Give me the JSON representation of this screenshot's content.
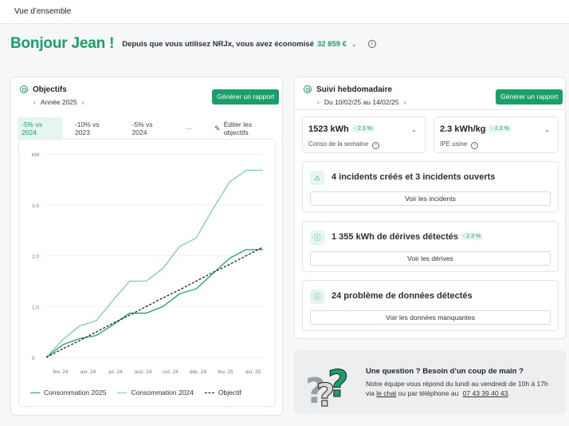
{
  "topbar": {
    "title": "Vue d’ensemble"
  },
  "greeting": {
    "title": "Bonjour Jean !",
    "subtitle": "Depuis que vous utilisez NRJx, vous avez économisé",
    "amount": "32 859 €"
  },
  "objectives": {
    "title": "Objectifs",
    "period": "Année 2025",
    "report_button": "Générer un rapport",
    "tabs": [
      "-5% vs 2024",
      "-10% vs 2023",
      "-5% vs 2024"
    ],
    "more_label": "···",
    "edit_label": "Éditer les objectifs"
  },
  "chart_data": {
    "type": "line",
    "ylabel": "kW",
    "ylim": [
      0,
      4
    ],
    "y_ticks": [
      "0",
      "1.0",
      "2.0",
      "3.0"
    ],
    "x_ticks": [
      "fev. 24",
      "avr. 24",
      "jui. 24",
      "aoû. 24",
      "oct. 24",
      "déc. 24",
      "fev. 25",
      "avr. 25"
    ],
    "x": [
      0,
      1,
      2,
      3,
      4,
      5,
      6,
      7,
      8,
      9,
      10,
      11,
      12,
      13
    ],
    "series": [
      {
        "name": "Consommation 2025",
        "color": "#1a9e6a",
        "dash": "solid",
        "values": [
          0.0,
          0.25,
          0.37,
          0.43,
          0.64,
          0.87,
          0.87,
          1.0,
          1.25,
          1.35,
          1.65,
          1.95,
          2.12,
          2.12
        ]
      },
      {
        "name": "Consommation 2024",
        "color": "#7dcfa8",
        "dash": "solid",
        "values": [
          0.0,
          0.35,
          0.62,
          0.72,
          1.12,
          1.5,
          1.5,
          1.75,
          2.18,
          2.35,
          2.92,
          3.45,
          3.68,
          3.68
        ]
      },
      {
        "name": "Objectif",
        "color": "#222222",
        "dash": "dashed",
        "values": [
          0.0,
          0.17,
          0.33,
          0.5,
          0.67,
          0.83,
          1.0,
          1.17,
          1.33,
          1.5,
          1.67,
          1.83,
          2.0,
          2.17
        ]
      }
    ],
    "grid": true,
    "legend": "bottom"
  },
  "weekly": {
    "title": "Suivi hebdomadaire",
    "period": "Du 10/02/25 au 14/02/25",
    "report_button": "Générer un rapport",
    "kpis": [
      {
        "value": "1523 kWh",
        "pct": "- 2.3 %",
        "label": "Conso de la semaine"
      },
      {
        "value": "2.3 kWh/kg",
        "pct": "- 2.3 %",
        "label": "IPE usine"
      }
    ],
    "alerts": [
      {
        "text": "4 incidents créés et 3 incidents ouverts",
        "pct": "",
        "button": "Voir les incidents"
      },
      {
        "text": "1 355 kWh de dérives détectés",
        "pct": "- 2.3 %",
        "button": "Voir les dérives"
      },
      {
        "text": "24 problème de données détectés",
        "pct": "",
        "button": "Voir les données manquantes"
      }
    ]
  },
  "help": {
    "question": "Une question ? Besoin d’un coup de main ?",
    "line1": "Notre équipe vous répond du lundi au vendredi de 10h à 17h",
    "line2_prefix": "via",
    "chat_link": "le chat",
    "line2_mid": "ou par téléphone au",
    "phone": "07 43 39 40 43",
    "line2_suffix": "."
  },
  "colors": {
    "accent": "#1a9e6a",
    "accent_light": "#7dcfa8",
    "badge_bg": "#e6f6ee"
  }
}
